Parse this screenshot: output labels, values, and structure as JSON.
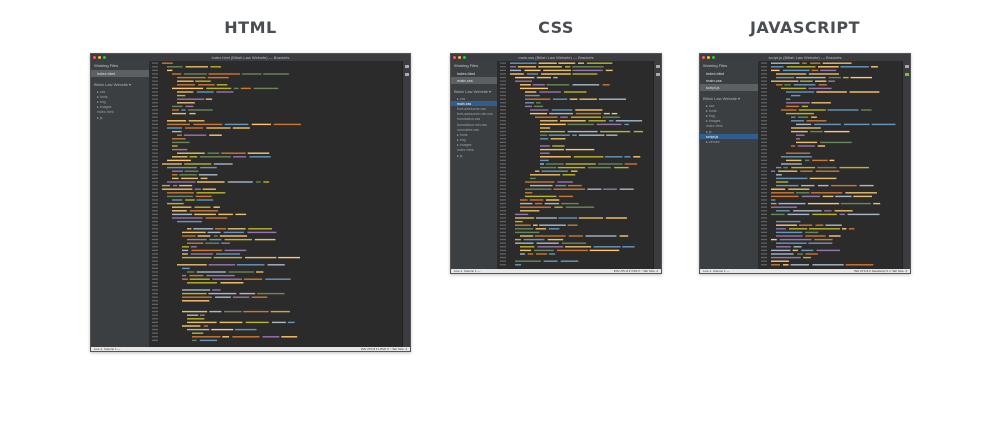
{
  "headings": {
    "html": "HTML",
    "css": "CSS",
    "javascript": "JAVASCRIPT"
  },
  "editors": {
    "html": {
      "window_title": "index.html (Bitlah Law Website) — Brackets",
      "sidebar": {
        "working_files_label": "Working Files",
        "working_files": [
          "index.html"
        ],
        "project_name": "Bitlah Law Website ▾",
        "tree": [
          "css",
          "fonts",
          "img",
          "images",
          "index.html",
          "js"
        ],
        "selected_index": -1
      },
      "status": {
        "left": "Line 1, Column 1 — ",
        "right": "INS   UTF-8 ▾   HTML ▾   ○   Tab Size: 4"
      }
    },
    "css": {
      "window_title": "main.css (Bitlah Law Website) — Brackets",
      "sidebar": {
        "working_files_label": "Working Files",
        "working_files": [
          "index.html",
          "main.css"
        ],
        "project_name": "Bitlah Law Website ▾",
        "tree": [
          "css",
          "main.css",
          "font-awesome.css",
          "font-awesome.min.css",
          "foundation.css",
          "foundation.min.css",
          "normalize.css",
          "fonts",
          "img",
          "images",
          "index.html",
          "js"
        ],
        "selected_index": 1
      },
      "status": {
        "left": "Line 1, Column 1 — ",
        "right": "INS   UTF-8 ▾   CSS ▾   ○   Tab Size: 4"
      }
    },
    "javascript": {
      "window_title": "script.js (Bitlah Law Website) — Brackets",
      "sidebar": {
        "working_files_label": "Working Files",
        "working_files": [
          "index.html",
          "main.css",
          "script.js"
        ],
        "project_name": "Bitlah Law Website ▾",
        "tree": [
          "css",
          "fonts",
          "img",
          "images",
          "index.html",
          "js",
          "script.js",
          "vendor"
        ],
        "selected_index": 6
      },
      "status": {
        "left": "Line 1, Column 1 — ",
        "right": "INS   UTF-8 ▾   JavaScript ▾   ⚠   Tab Size: 4"
      }
    }
  },
  "colors": {
    "editor_bg": "#2b2b2b",
    "line_number": "#5f6266",
    "syntax": [
      "#e8bf6a",
      "#9876aa",
      "#6a8759",
      "#cc7832",
      "#a9b7c6",
      "#bbb529",
      "#6897bb",
      "#ffc66d"
    ]
  }
}
